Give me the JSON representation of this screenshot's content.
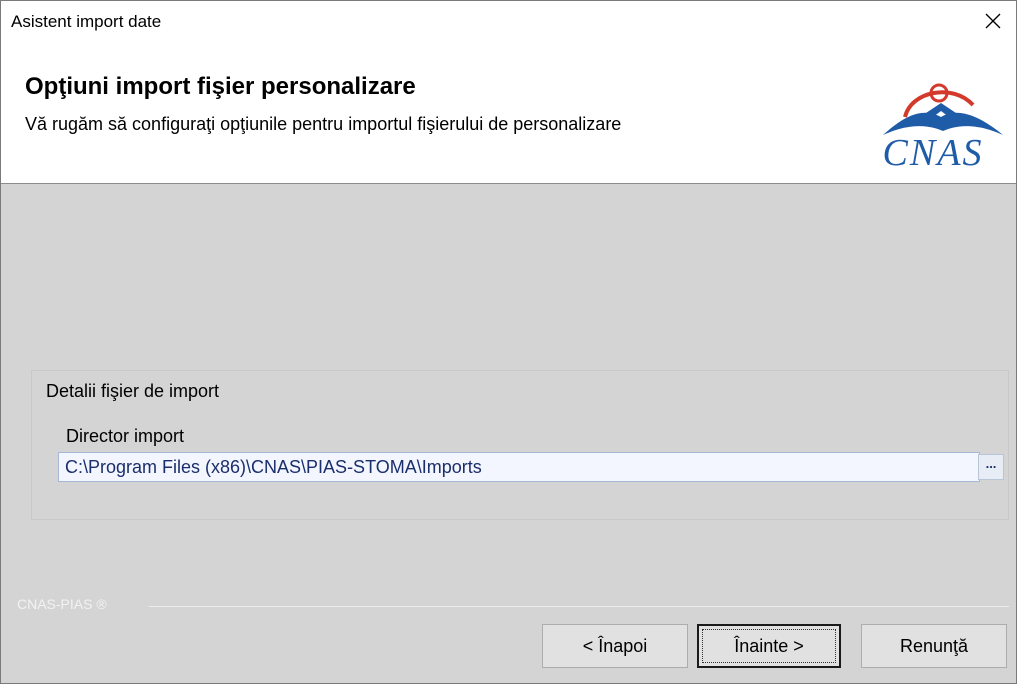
{
  "window": {
    "title": "Asistent import date",
    "close_glyph": "✕"
  },
  "header": {
    "title": "Opţiuni import fişier personalizare",
    "subtitle": "Vă rugăm să configuraţi opţiunile pentru importul fişierului de personalizare",
    "logo_text": "CNAS"
  },
  "group": {
    "title": "Detalii fişier de import",
    "field_label": "Director import",
    "field_value": "C:\\Program Files (x86)\\CNAS\\PIAS-STOMA\\Imports",
    "browse_label": "..."
  },
  "footer": {
    "brand": "CNAS-PIAS ®",
    "back_label": "< Înapoi",
    "next_label": "Înainte >",
    "cancel_label": "Renunţă"
  },
  "colors": {
    "logo_blue": "#1f5ca8",
    "logo_red": "#d33a2c",
    "field_bg": "#f3f5ff",
    "dialog_bg": "#d4d4d4"
  }
}
